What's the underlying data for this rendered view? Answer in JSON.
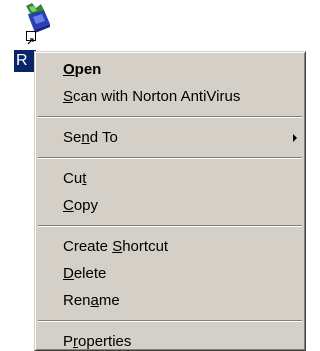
{
  "desktop_icon": {
    "label": "R",
    "icon": "book-shortcut-icon",
    "shortcut_arrow": "shortcut-arrow-icon"
  },
  "menu": {
    "items": [
      {
        "pre": "",
        "acc": "O",
        "post": "pen",
        "bold": true
      },
      {
        "pre": "",
        "acc": "S",
        "post": "can with Norton AntiVirus"
      },
      {
        "pre": "Se",
        "acc": "n",
        "post": "d To",
        "submenu": true
      },
      {
        "pre": "Cu",
        "acc": "t",
        "post": ""
      },
      {
        "pre": "",
        "acc": "C",
        "post": "opy"
      },
      {
        "pre": "Create ",
        "acc": "S",
        "post": "hortcut"
      },
      {
        "pre": "",
        "acc": "D",
        "post": "elete"
      },
      {
        "pre": "Ren",
        "acc": "a",
        "post": "me"
      },
      {
        "pre": "P",
        "acc": "r",
        "post": "operties"
      }
    ]
  },
  "colors": {
    "menu_face": "#d4d0c8",
    "selection": "#0a246a"
  }
}
